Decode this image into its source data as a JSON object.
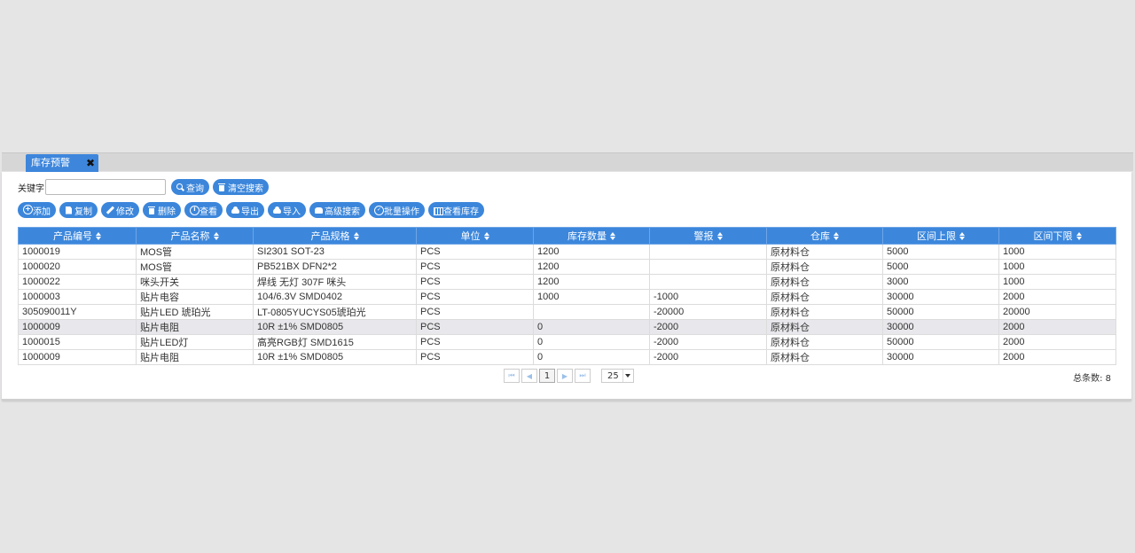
{
  "tab": {
    "title": "库存预警",
    "close": "✖"
  },
  "search": {
    "label": "关键字",
    "value": "",
    "placeholder": ""
  },
  "search_buttons": [
    {
      "label": "查询",
      "icon": "search-icon"
    },
    {
      "label": "清空搜索",
      "icon": "trash-icon"
    }
  ],
  "toolbar": [
    {
      "label": "添加",
      "icon": "plus-circle-icon"
    },
    {
      "label": "复制",
      "icon": "copy-icon"
    },
    {
      "label": "修改",
      "icon": "pencil-icon"
    },
    {
      "label": "删除",
      "icon": "trash-icon"
    },
    {
      "label": "查看",
      "icon": "info-icon"
    },
    {
      "label": "导出",
      "icon": "cloud-download-icon"
    },
    {
      "label": "导入",
      "icon": "cloud-upload-icon"
    },
    {
      "label": "高级搜索",
      "icon": "phone-icon"
    },
    {
      "label": "批量操作",
      "icon": "check-circle-icon"
    },
    {
      "label": "查看库存",
      "icon": "barcode-icon"
    }
  ],
  "table": {
    "columns": [
      "产品编号",
      "产品名称",
      "产品规格",
      "单位",
      "库存数量",
      "警报",
      "仓库",
      "区间上限",
      "区间下限"
    ],
    "rows": [
      [
        "1000019",
        "MOS管",
        "SI2301 SOT-23",
        "PCS",
        "1200",
        "",
        "原材料仓",
        "5000",
        "1000"
      ],
      [
        "1000020",
        "MOS管",
        "PB521BX DFN2*2",
        "PCS",
        "1200",
        "",
        "原材料仓",
        "5000",
        "1000"
      ],
      [
        "1000022",
        "咪头开关",
        "焊线 无灯 307F 咪头",
        "PCS",
        "1200",
        "",
        "原材料仓",
        "3000",
        "1000"
      ],
      [
        "1000003",
        "贴片电容",
        "104/6.3V SMD0402",
        "PCS",
        "1000",
        "-1000",
        "原材料仓",
        "30000",
        "2000"
      ],
      [
        "305090011Y",
        "贴片LED 琥珀光",
        "LT-0805YUCYS05琥珀光",
        "PCS",
        "",
        "-20000",
        "原材料仓",
        "50000",
        "20000"
      ],
      [
        "1000009",
        "贴片电阻",
        "10R ±1% SMD0805",
        "PCS",
        "0",
        "-2000",
        "原材料仓",
        "30000",
        "2000"
      ],
      [
        "1000015",
        "贴片LED灯",
        "高亮RGB灯 SMD1615",
        "PCS",
        "0",
        "-2000",
        "原材料仓",
        "50000",
        "2000"
      ],
      [
        "1000009",
        "贴片电阻",
        "10R ±1% SMD0805",
        "PCS",
        "0",
        "-2000",
        "原材料仓",
        "30000",
        "2000"
      ]
    ],
    "highlighted_row": 5
  },
  "pager": {
    "current_page": "1",
    "page_size": "25"
  },
  "total": "总条数: 8",
  "colors": {
    "accent": "#3b86db",
    "header_bg": "#3c87dc",
    "page_bg": "#e6e5e6"
  }
}
